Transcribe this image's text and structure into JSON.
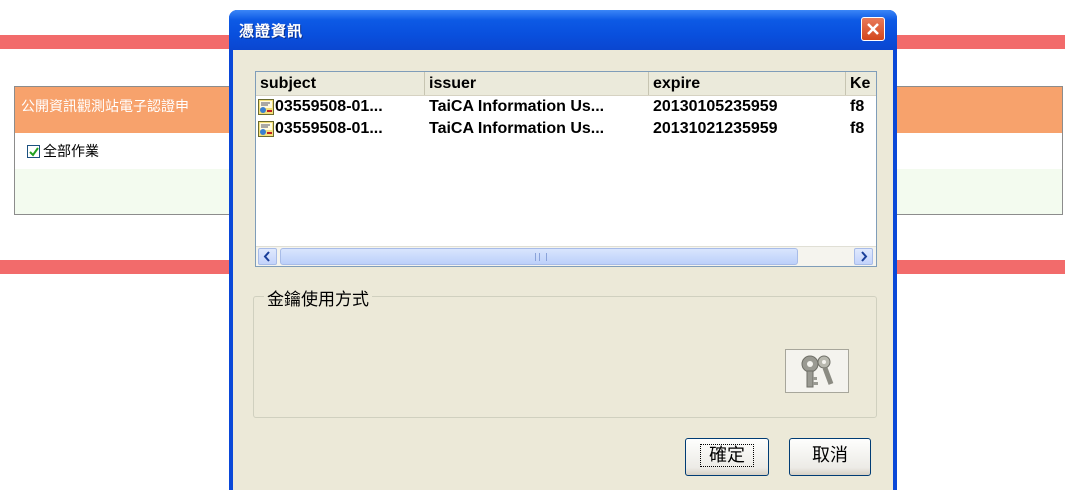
{
  "background_page": {
    "panel_title": "公開資訊觀測站電子認證申",
    "checkbox_label": "全部作業",
    "checkbox_checked": true
  },
  "dialog": {
    "title": "憑證資訊",
    "list": {
      "columns": [
        "subject",
        "issuer",
        "expire",
        "Ke"
      ],
      "rows": [
        {
          "subject": "03559508-01...",
          "issuer": "TaiCA Information Us...",
          "expire": "20130105235959",
          "key": "f8"
        },
        {
          "subject": "03559508-01...",
          "issuer": "TaiCA Information Us...",
          "expire": "20131021235959",
          "key": "f8"
        }
      ]
    },
    "group_label": "金鑰使用方式",
    "ok_label": "確定",
    "cancel_label": "取消"
  },
  "colors": {
    "title_bar": "#0a50de",
    "red_bar": "#f26b6b",
    "panel_header": "#f7a26c"
  }
}
